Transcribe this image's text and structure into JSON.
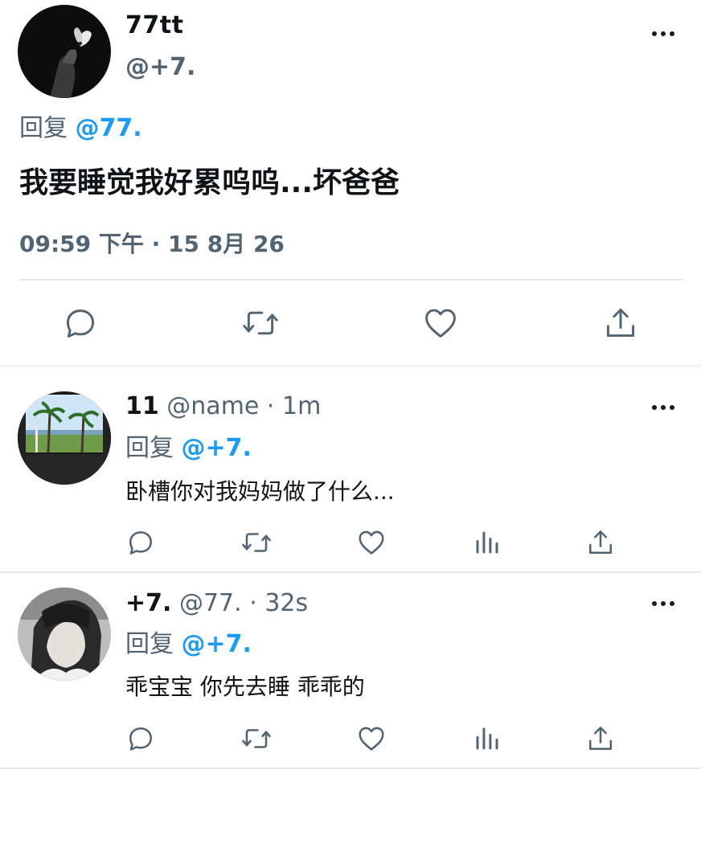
{
  "main_tweet": {
    "display_name": "77tt",
    "handle": "@+7.",
    "reply_prefix": "回复",
    "reply_mention": "@77.",
    "text": "我要睡觉我好累呜呜...坏爸爸",
    "timestamp": "09:59 下午 · 15 8月 26",
    "actions": [
      "reply-icon",
      "retweet-icon",
      "like-icon",
      "share-icon"
    ]
  },
  "replies": [
    {
      "display_name": "11",
      "handle": "@name",
      "separator": "·",
      "time": "1m",
      "reply_prefix": "回复",
      "reply_mention": "@+7.",
      "text": "卧槽你对我妈妈做了什么...",
      "actions": [
        "reply-icon",
        "retweet-icon",
        "like-icon",
        "analytics-icon",
        "share-icon"
      ]
    },
    {
      "display_name": "+7.",
      "handle": "@77.",
      "separator": "·",
      "time": "32s",
      "reply_prefix": "回复",
      "reply_mention": "@+7.",
      "text": "乖宝宝 你先去睡 乖乖的",
      "actions": [
        "reply-icon",
        "retweet-icon",
        "like-icon",
        "analytics-icon",
        "share-icon"
      ]
    }
  ],
  "colors": {
    "text_primary": "#0f1419",
    "text_secondary": "#536471",
    "mention": "#1d9bf0",
    "divider": "#e7e9ea"
  }
}
